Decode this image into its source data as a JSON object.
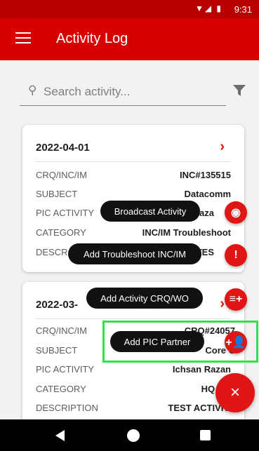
{
  "status_bar": {
    "time": "9:31",
    "signal_icons": "▼◢ ▮"
  },
  "app_bar": {
    "title": "Activity Log",
    "menu_icon": "hamburger-menu-icon"
  },
  "search": {
    "placeholder": "Search activity...",
    "icon": "search-icon"
  },
  "filter": {
    "icon": "filter-icon"
  },
  "cards": [
    {
      "date": "2022-04-01",
      "rows": [
        {
          "label": "CRQ/INC/IM",
          "value": "INC#135515"
        },
        {
          "label": "SUBJECT",
          "value": "Datacomm"
        },
        {
          "label": "PIC ACTIVITY",
          "value": "Raza"
        },
        {
          "label": "CATEGORY",
          "value": "INC/IM Troubleshoot"
        },
        {
          "label": "DESCR",
          "value": "E TES"
        }
      ]
    },
    {
      "date": "2022-03-",
      "rows": [
        {
          "label": "CRQ/INC/IM",
          "value": "CRQ#24057"
        },
        {
          "label": "SUBJECT",
          "value": "Core C"
        },
        {
          "label": "PIC ACTIVITY",
          "value": "Ichsan Razan"
        },
        {
          "label": "CATEGORY",
          "value": "HQ Proj"
        },
        {
          "label": "DESCRIPTION",
          "value": "TEST ACTIVITY"
        }
      ]
    }
  ],
  "speed_dial": {
    "actions": [
      {
        "label": "Broadcast Activity",
        "icon": "broadcast-icon",
        "glyph": "◉"
      },
      {
        "label": "Add Troubleshoot INC/IM",
        "icon": "alert-icon",
        "glyph": "!"
      },
      {
        "label": "Add Activity CRQ/WO",
        "icon": "playlist-add-icon",
        "glyph": "≡+"
      },
      {
        "label": "Add PIC Partner",
        "icon": "person-add-icon",
        "glyph": "+👤"
      }
    ],
    "close_glyph": "×"
  }
}
